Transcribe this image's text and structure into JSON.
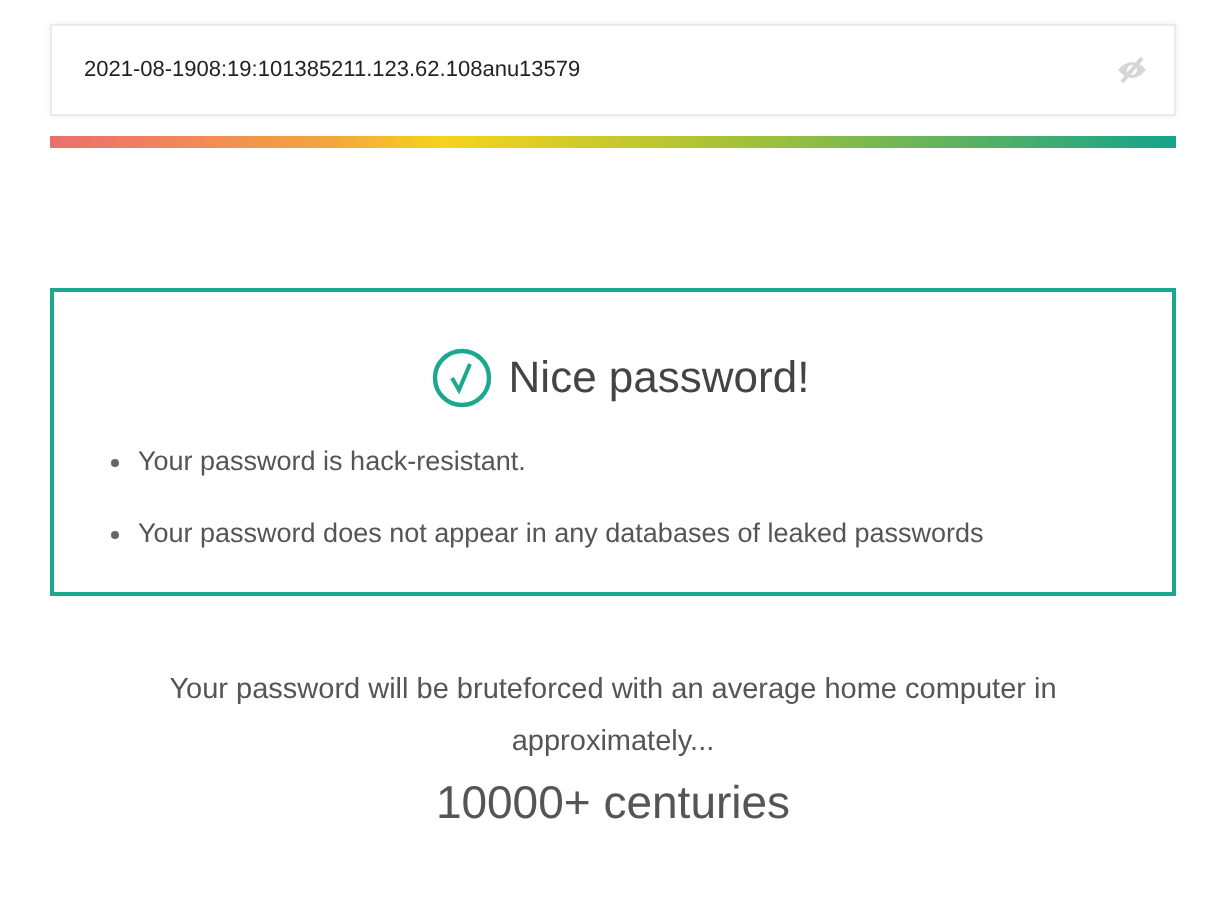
{
  "password_field": {
    "value": "2021-08-1908:19:101385211.123.62.108anu13579"
  },
  "strength_meter": {
    "level": 1
  },
  "result": {
    "title": "Nice password!",
    "points": [
      "Your password is hack-resistant.",
      "Your password does not appear in any databases of leaked passwords"
    ]
  },
  "estimate": {
    "text": "Your password will be bruteforced with an average home computer in approximately...",
    "time": "10000+ centuries"
  }
}
